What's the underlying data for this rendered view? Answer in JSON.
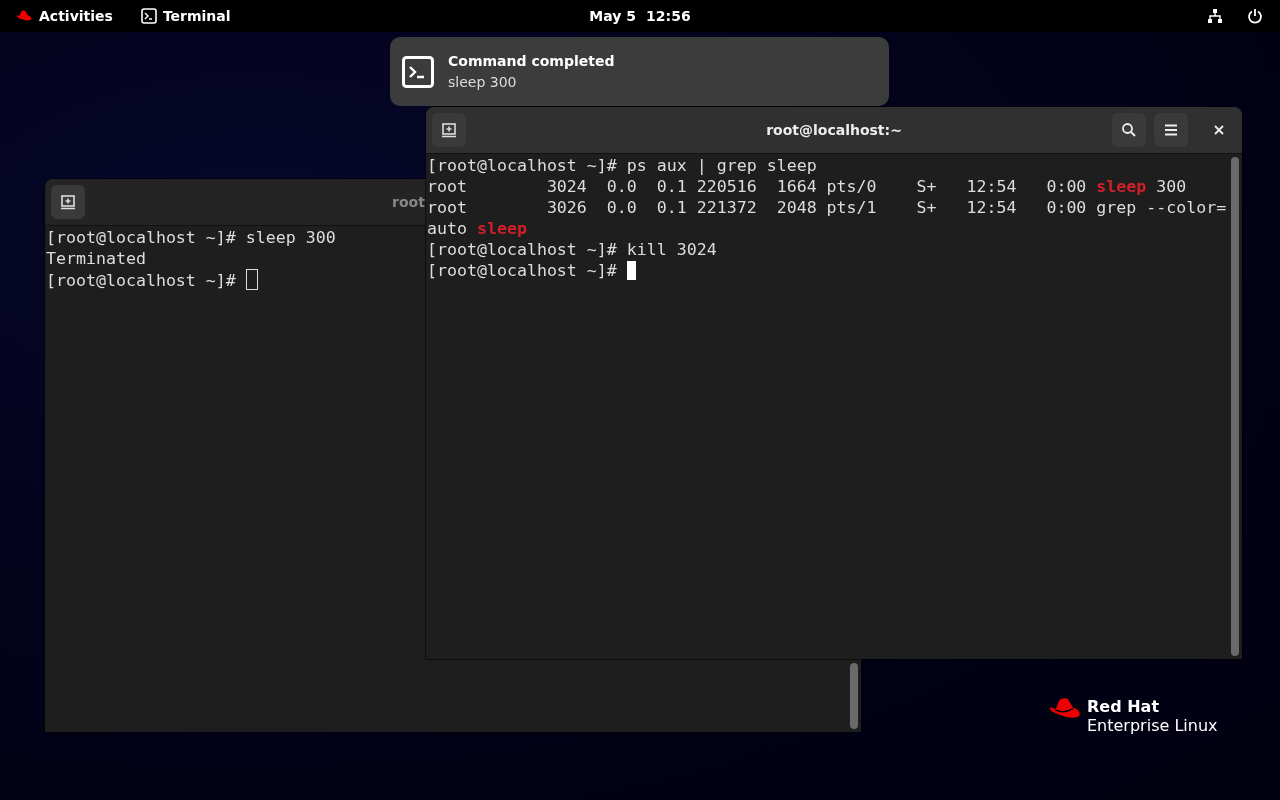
{
  "top_bar": {
    "activities": "Activities",
    "app": "Terminal",
    "date": "May 5",
    "time": "12:56"
  },
  "notification": {
    "title": "Command completed",
    "body": "sleep 300"
  },
  "windows": [
    {
      "title": "root",
      "focused": false,
      "lines": [
        [
          {
            "text": "[root@localhost ~]# sleep 300",
            "kind": "plain"
          }
        ],
        [
          {
            "text": "Terminated",
            "kind": "plain"
          }
        ],
        [
          {
            "text": "[root@localhost ~]# ",
            "kind": "plain"
          }
        ]
      ]
    },
    {
      "title": "root@localhost:~",
      "focused": true,
      "lines": [
        [
          {
            "text": "[root@localhost ~]# ps aux | grep sleep",
            "kind": "plain"
          }
        ],
        [
          {
            "text": "root        3024  0.0  0.1 220516  1664 pts/0    S+   12:54   0:00 ",
            "kind": "plain"
          },
          {
            "text": "sleep",
            "kind": "match"
          },
          {
            "text": " 300",
            "kind": "plain"
          }
        ],
        [
          {
            "text": "root        3026  0.0  0.1 221372  2048 pts/1    S+   12:54   0:00 grep --color=",
            "kind": "plain"
          }
        ],
        [
          {
            "text": "auto ",
            "kind": "plain"
          },
          {
            "text": "sleep",
            "kind": "match"
          }
        ],
        [
          {
            "text": "[root@localhost ~]# kill 3024",
            "kind": "plain"
          }
        ],
        [
          {
            "text": "[root@localhost ~]# ",
            "kind": "plain"
          }
        ]
      ]
    }
  ],
  "branding": {
    "line_1": "Red Hat",
    "line_2": "Enterprise Linux"
  }
}
